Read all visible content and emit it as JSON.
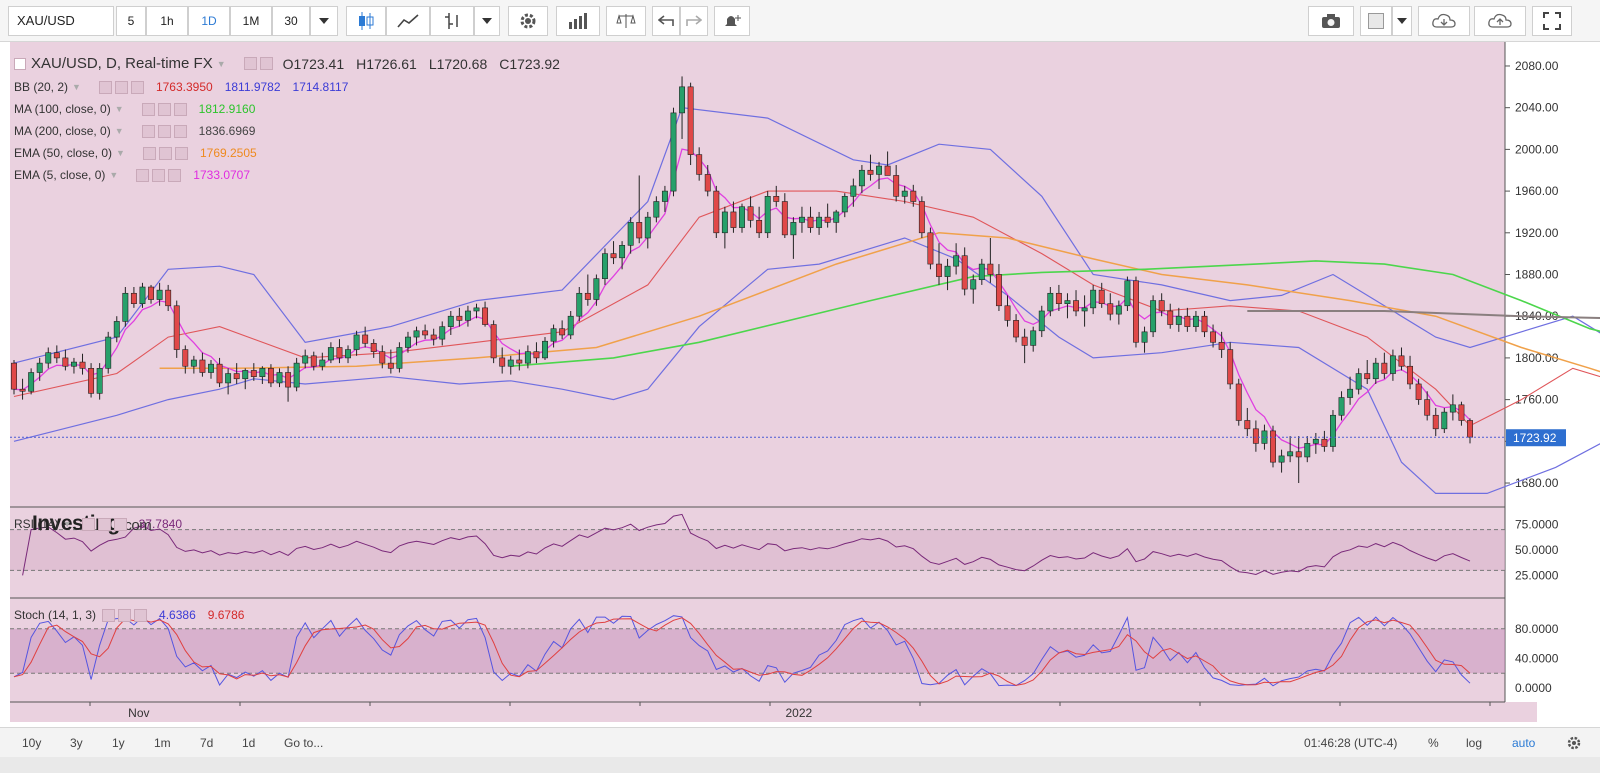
{
  "toolbar": {
    "symbol": "XAU/USD",
    "intervals": [
      "5",
      "1h",
      "1D",
      "1M",
      "30"
    ],
    "active_interval": "1D"
  },
  "legend": {
    "main": {
      "symbol": "XAU/USD, D, Real-time FX",
      "o": "O1723.41",
      "h": "H1726.61",
      "l": "L1720.68",
      "c": "C1723.92"
    },
    "bb": {
      "label": "BB (20, 2)",
      "mid": "1763.3950",
      "upper": "1811.9782",
      "lower": "1714.8117"
    },
    "ma100": {
      "label": "MA (100, close, 0)",
      "value": "1812.9160"
    },
    "ma200": {
      "label": "MA (200, close, 0)",
      "value": "1836.6969"
    },
    "ema50": {
      "label": "EMA (50, close, 0)",
      "value": "1769.2505"
    },
    "ema5": {
      "label": "EMA (5, close, 0)",
      "value": "1733.0707"
    },
    "rsi": {
      "label": "RSI (14)",
      "value": "37.7840"
    },
    "stoch": {
      "label": "Stoch (14, 1, 3)",
      "k": "4.6386",
      "d": "9.6786"
    }
  },
  "logo": {
    "brand": "Investing",
    "suffix": ".com"
  },
  "price_label": "1723.92",
  "bottombar": {
    "ranges": [
      "10y",
      "3y",
      "1y",
      "1m",
      "7d",
      "1d"
    ],
    "goto": "Go to...",
    "time": "01:46:28 (UTC-4)",
    "percent": "%",
    "log": "log",
    "auto": "auto"
  },
  "colors": {
    "background": "#ead1df",
    "up": "#27a06a",
    "down": "#e04848",
    "bb_band": "#6f6fe0",
    "bb_mid": "#e0565a",
    "ma100": "#4cd64c",
    "ma200": "#8a7f7f",
    "ema50": "#f0a14a",
    "ema5": "#e040e0",
    "rsi_line": "#7a2a7a",
    "stoch_k": "#5555e0",
    "stoch_d": "#e04040"
  },
  "chart_data": {
    "type": "candlestick",
    "title": "XAU/USD, D, Real-time FX",
    "price_axis": {
      "ticks": [
        1680,
        1720,
        1760,
        1800,
        1840,
        1880,
        1920,
        1960,
        2000,
        2040,
        2080
      ],
      "range": [
        1657,
        2103
      ]
    },
    "time_axis": {
      "labels": [
        "Nov",
        "2022"
      ]
    },
    "last_price": 1723.92,
    "candles": [
      [
        1795,
        1798,
        1765,
        1770
      ],
      [
        1770,
        1780,
        1760,
        1768
      ],
      [
        1768,
        1790,
        1765,
        1786
      ],
      [
        1786,
        1800,
        1778,
        1795
      ],
      [
        1795,
        1810,
        1790,
        1805
      ],
      [
        1805,
        1812,
        1795,
        1800
      ],
      [
        1800,
        1808,
        1788,
        1792
      ],
      [
        1792,
        1800,
        1785,
        1796
      ],
      [
        1796,
        1804,
        1784,
        1790
      ],
      [
        1790,
        1795,
        1762,
        1766
      ],
      [
        1766,
        1795,
        1760,
        1790
      ],
      [
        1790,
        1825,
        1785,
        1820
      ],
      [
        1820,
        1840,
        1815,
        1835
      ],
      [
        1835,
        1868,
        1830,
        1862
      ],
      [
        1862,
        1868,
        1848,
        1852
      ],
      [
        1852,
        1872,
        1848,
        1868
      ],
      [
        1868,
        1870,
        1852,
        1856
      ],
      [
        1856,
        1872,
        1850,
        1865
      ],
      [
        1865,
        1870,
        1845,
        1850
      ],
      [
        1850,
        1855,
        1800,
        1808
      ],
      [
        1808,
        1812,
        1785,
        1792
      ],
      [
        1792,
        1802,
        1785,
        1798
      ],
      [
        1798,
        1805,
        1782,
        1786
      ],
      [
        1786,
        1798,
        1780,
        1794
      ],
      [
        1794,
        1800,
        1772,
        1776
      ],
      [
        1776,
        1790,
        1765,
        1785
      ],
      [
        1785,
        1795,
        1775,
        1780
      ],
      [
        1780,
        1790,
        1770,
        1788
      ],
      [
        1788,
        1795,
        1778,
        1782
      ],
      [
        1782,
        1792,
        1775,
        1790
      ],
      [
        1790,
        1794,
        1772,
        1776
      ],
      [
        1776,
        1790,
        1772,
        1786
      ],
      [
        1786,
        1792,
        1758,
        1772
      ],
      [
        1772,
        1800,
        1768,
        1795
      ],
      [
        1795,
        1808,
        1790,
        1802
      ],
      [
        1802,
        1806,
        1788,
        1792
      ],
      [
        1792,
        1805,
        1788,
        1798
      ],
      [
        1798,
        1815,
        1795,
        1810
      ],
      [
        1810,
        1818,
        1795,
        1800
      ],
      [
        1800,
        1812,
        1795,
        1808
      ],
      [
        1808,
        1826,
        1802,
        1822
      ],
      [
        1822,
        1830,
        1810,
        1814
      ],
      [
        1814,
        1818,
        1800,
        1806
      ],
      [
        1806,
        1812,
        1790,
        1795
      ],
      [
        1795,
        1808,
        1785,
        1790
      ],
      [
        1790,
        1815,
        1786,
        1810
      ],
      [
        1810,
        1825,
        1805,
        1820
      ],
      [
        1820,
        1830,
        1812,
        1826
      ],
      [
        1826,
        1832,
        1818,
        1822
      ],
      [
        1822,
        1828,
        1812,
        1818
      ],
      [
        1818,
        1835,
        1812,
        1830
      ],
      [
        1830,
        1845,
        1822,
        1840
      ],
      [
        1840,
        1848,
        1830,
        1836
      ],
      [
        1836,
        1850,
        1830,
        1845
      ],
      [
        1845,
        1852,
        1838,
        1848
      ],
      [
        1848,
        1854,
        1830,
        1832
      ],
      [
        1832,
        1836,
        1795,
        1800
      ],
      [
        1800,
        1810,
        1785,
        1792
      ],
      [
        1792,
        1802,
        1784,
        1798
      ],
      [
        1798,
        1808,
        1788,
        1795
      ],
      [
        1795,
        1812,
        1790,
        1806
      ],
      [
        1806,
        1815,
        1795,
        1800
      ],
      [
        1800,
        1820,
        1798,
        1816
      ],
      [
        1816,
        1832,
        1810,
        1828
      ],
      [
        1828,
        1836,
        1818,
        1822
      ],
      [
        1822,
        1845,
        1818,
        1840
      ],
      [
        1840,
        1868,
        1835,
        1862
      ],
      [
        1862,
        1880,
        1850,
        1856
      ],
      [
        1856,
        1880,
        1850,
        1876
      ],
      [
        1876,
        1905,
        1870,
        1900
      ],
      [
        1900,
        1912,
        1890,
        1896
      ],
      [
        1896,
        1912,
        1885,
        1908
      ],
      [
        1908,
        1935,
        1900,
        1930
      ],
      [
        1930,
        1975,
        1910,
        1915
      ],
      [
        1915,
        1940,
        1905,
        1935
      ],
      [
        1935,
        1955,
        1930,
        1950
      ],
      [
        1950,
        1965,
        1940,
        1960
      ],
      [
        1960,
        2040,
        1955,
        2035
      ],
      [
        2035,
        2070,
        2010,
        2060
      ],
      [
        2060,
        2064,
        1985,
        1995
      ],
      [
        1995,
        2002,
        1970,
        1976
      ],
      [
        1976,
        1985,
        1955,
        1960
      ],
      [
        1960,
        1965,
        1915,
        1920
      ],
      [
        1920,
        1945,
        1905,
        1940
      ],
      [
        1940,
        1950,
        1920,
        1925
      ],
      [
        1925,
        1948,
        1920,
        1945
      ],
      [
        1945,
        1955,
        1925,
        1932
      ],
      [
        1932,
        1945,
        1915,
        1920
      ],
      [
        1920,
        1960,
        1915,
        1955
      ],
      [
        1955,
        1965,
        1945,
        1950
      ],
      [
        1950,
        1958,
        1915,
        1918
      ],
      [
        1918,
        1935,
        1895,
        1930
      ],
      [
        1930,
        1945,
        1920,
        1935
      ],
      [
        1935,
        1945,
        1920,
        1925
      ],
      [
        1925,
        1940,
        1918,
        1935
      ],
      [
        1935,
        1948,
        1925,
        1930
      ],
      [
        1930,
        1942,
        1920,
        1940
      ],
      [
        1940,
        1958,
        1935,
        1955
      ],
      [
        1955,
        1972,
        1945,
        1965
      ],
      [
        1965,
        1985,
        1958,
        1980
      ],
      [
        1980,
        1995,
        1970,
        1976
      ],
      [
        1976,
        1988,
        1962,
        1984
      ],
      [
        1984,
        1998,
        1975,
        1975
      ],
      [
        1975,
        1985,
        1950,
        1955
      ],
      [
        1955,
        1965,
        1948,
        1960
      ],
      [
        1960,
        1966,
        1945,
        1950
      ],
      [
        1950,
        1955,
        1915,
        1920
      ],
      [
        1920,
        1925,
        1885,
        1890
      ],
      [
        1890,
        1910,
        1870,
        1878
      ],
      [
        1878,
        1895,
        1865,
        1888
      ],
      [
        1888,
        1910,
        1880,
        1898
      ],
      [
        1898,
        1906,
        1860,
        1866
      ],
      [
        1866,
        1880,
        1852,
        1875
      ],
      [
        1875,
        1895,
        1870,
        1890
      ],
      [
        1890,
        1915,
        1872,
        1880
      ],
      [
        1880,
        1890,
        1845,
        1850
      ],
      [
        1850,
        1860,
        1830,
        1836
      ],
      [
        1836,
        1842,
        1815,
        1820
      ],
      [
        1820,
        1828,
        1795,
        1812
      ],
      [
        1812,
        1830,
        1806,
        1826
      ],
      [
        1826,
        1850,
        1820,
        1845
      ],
      [
        1845,
        1868,
        1840,
        1862
      ],
      [
        1862,
        1870,
        1845,
        1852
      ],
      [
        1852,
        1862,
        1838,
        1855
      ],
      [
        1855,
        1865,
        1840,
        1845
      ],
      [
        1845,
        1860,
        1830,
        1848
      ],
      [
        1848,
        1870,
        1842,
        1865
      ],
      [
        1865,
        1872,
        1848,
        1852
      ],
      [
        1852,
        1862,
        1836,
        1842
      ],
      [
        1842,
        1855,
        1832,
        1850
      ],
      [
        1850,
        1878,
        1845,
        1874
      ],
      [
        1874,
        1878,
        1810,
        1815
      ],
      [
        1815,
        1830,
        1805,
        1825
      ],
      [
        1825,
        1860,
        1820,
        1855
      ],
      [
        1855,
        1862,
        1840,
        1845
      ],
      [
        1845,
        1852,
        1828,
        1832
      ],
      [
        1832,
        1848,
        1825,
        1840
      ],
      [
        1840,
        1848,
        1825,
        1830
      ],
      [
        1830,
        1845,
        1825,
        1840
      ],
      [
        1840,
        1845,
        1820,
        1825
      ],
      [
        1825,
        1832,
        1810,
        1815
      ],
      [
        1815,
        1825,
        1800,
        1808
      ],
      [
        1808,
        1815,
        1770,
        1775
      ],
      [
        1775,
        1780,
        1735,
        1740
      ],
      [
        1740,
        1752,
        1725,
        1732
      ],
      [
        1732,
        1740,
        1710,
        1718
      ],
      [
        1718,
        1736,
        1712,
        1730
      ],
      [
        1730,
        1735,
        1695,
        1700
      ],
      [
        1700,
        1712,
        1690,
        1706
      ],
      [
        1706,
        1725,
        1700,
        1710
      ],
      [
        1710,
        1725,
        1680,
        1705
      ],
      [
        1705,
        1725,
        1700,
        1718
      ],
      [
        1718,
        1728,
        1708,
        1722
      ],
      [
        1722,
        1730,
        1710,
        1715
      ],
      [
        1715,
        1750,
        1710,
        1745
      ],
      [
        1745,
        1768,
        1740,
        1762
      ],
      [
        1762,
        1782,
        1755,
        1770
      ],
      [
        1770,
        1790,
        1765,
        1785
      ],
      [
        1785,
        1798,
        1775,
        1780
      ],
      [
        1780,
        1800,
        1775,
        1795
      ],
      [
        1795,
        1805,
        1780,
        1785
      ],
      [
        1785,
        1808,
        1778,
        1802
      ],
      [
        1802,
        1810,
        1788,
        1792
      ],
      [
        1792,
        1802,
        1770,
        1775
      ],
      [
        1775,
        1780,
        1755,
        1760
      ],
      [
        1760,
        1768,
        1740,
        1745
      ],
      [
        1745,
        1752,
        1725,
        1732
      ],
      [
        1732,
        1752,
        1728,
        1748
      ],
      [
        1748,
        1765,
        1740,
        1755
      ],
      [
        1755,
        1758,
        1735,
        1740
      ],
      [
        1740,
        1742,
        1718,
        1724
      ]
    ],
    "bb_upper": [
      [
        0,
        1795
      ],
      [
        12,
        1820
      ],
      [
        18,
        1885
      ],
      [
        24,
        1888
      ],
      [
        28,
        1880
      ],
      [
        34,
        1815
      ],
      [
        44,
        1830
      ],
      [
        54,
        1855
      ],
      [
        64,
        1865
      ],
      [
        74,
        1950
      ],
      [
        78,
        2040
      ],
      [
        88,
        2030
      ],
      [
        98,
        1990
      ],
      [
        102,
        1985
      ],
      [
        108,
        2005
      ],
      [
        114,
        2000
      ],
      [
        120,
        1955
      ],
      [
        126,
        1880
      ],
      [
        134,
        1870
      ],
      [
        142,
        1855
      ],
      [
        148,
        1860
      ],
      [
        154,
        1880
      ],
      [
        160,
        1850
      ],
      [
        166,
        1820
      ],
      [
        170,
        1810
      ],
      [
        182,
        1840
      ],
      [
        188,
        1810
      ],
      [
        192,
        1812
      ]
    ],
    "bb_mid": [
      [
        0,
        1763
      ],
      [
        12,
        1785
      ],
      [
        18,
        1820
      ],
      [
        24,
        1830
      ],
      [
        34,
        1800
      ],
      [
        44,
        1805
      ],
      [
        54,
        1815
      ],
      [
        64,
        1825
      ],
      [
        74,
        1870
      ],
      [
        80,
        1935
      ],
      [
        88,
        1960
      ],
      [
        96,
        1960
      ],
      [
        104,
        1950
      ],
      [
        112,
        1935
      ],
      [
        120,
        1900
      ],
      [
        126,
        1870
      ],
      [
        134,
        1845
      ],
      [
        142,
        1850
      ],
      [
        150,
        1845
      ],
      [
        158,
        1820
      ],
      [
        166,
        1770
      ],
      [
        170,
        1735
      ],
      [
        176,
        1760
      ],
      [
        182,
        1790
      ],
      [
        188,
        1775
      ],
      [
        192,
        1763
      ]
    ],
    "bb_lower": [
      [
        0,
        1720
      ],
      [
        12,
        1745
      ],
      [
        18,
        1760
      ],
      [
        24,
        1770
      ],
      [
        28,
        1780
      ],
      [
        34,
        1775
      ],
      [
        44,
        1782
      ],
      [
        52,
        1775
      ],
      [
        58,
        1778
      ],
      [
        64,
        1770
      ],
      [
        70,
        1760
      ],
      [
        74,
        1770
      ],
      [
        80,
        1830
      ],
      [
        88,
        1885
      ],
      [
        94,
        1890
      ],
      [
        104,
        1915
      ],
      [
        110,
        1895
      ],
      [
        116,
        1860
      ],
      [
        122,
        1820
      ],
      [
        126,
        1800
      ],
      [
        134,
        1805
      ],
      [
        142,
        1815
      ],
      [
        150,
        1810
      ],
      [
        158,
        1770
      ],
      [
        162,
        1700
      ],
      [
        166,
        1670
      ],
      [
        172,
        1670
      ],
      [
        180,
        1695
      ],
      [
        188,
        1730
      ],
      [
        192,
        1715
      ]
    ],
    "ma100": [
      [
        58,
        1792
      ],
      [
        70,
        1800
      ],
      [
        80,
        1815
      ],
      [
        100,
        1855
      ],
      [
        112,
        1878
      ],
      [
        120,
        1882
      ],
      [
        132,
        1885
      ],
      [
        145,
        1890
      ],
      [
        152,
        1893
      ],
      [
        160,
        1890
      ],
      [
        168,
        1880
      ],
      [
        176,
        1855
      ],
      [
        184,
        1828
      ],
      [
        192,
        1812
      ]
    ],
    "ma200": [
      [
        144,
        1845
      ],
      [
        160,
        1845
      ],
      [
        176,
        1840
      ],
      [
        192,
        1837
      ]
    ],
    "ema50": [
      [
        17,
        1790
      ],
      [
        26,
        1790
      ],
      [
        40,
        1792
      ],
      [
        54,
        1800
      ],
      [
        68,
        1810
      ],
      [
        80,
        1840
      ],
      [
        96,
        1890
      ],
      [
        108,
        1920
      ],
      [
        116,
        1915
      ],
      [
        126,
        1895
      ],
      [
        134,
        1880
      ],
      [
        144,
        1870
      ],
      [
        156,
        1855
      ],
      [
        166,
        1840
      ],
      [
        176,
        1810
      ],
      [
        184,
        1790
      ],
      [
        192,
        1769
      ]
    ]
  },
  "rsi_data": {
    "ticks": [
      25,
      50,
      75
    ],
    "upper_band": 70,
    "lower_band": 30
  },
  "stoch_data": {
    "ticks": [
      0,
      40,
      80
    ],
    "upper_band": 80,
    "lower_band": 20
  }
}
